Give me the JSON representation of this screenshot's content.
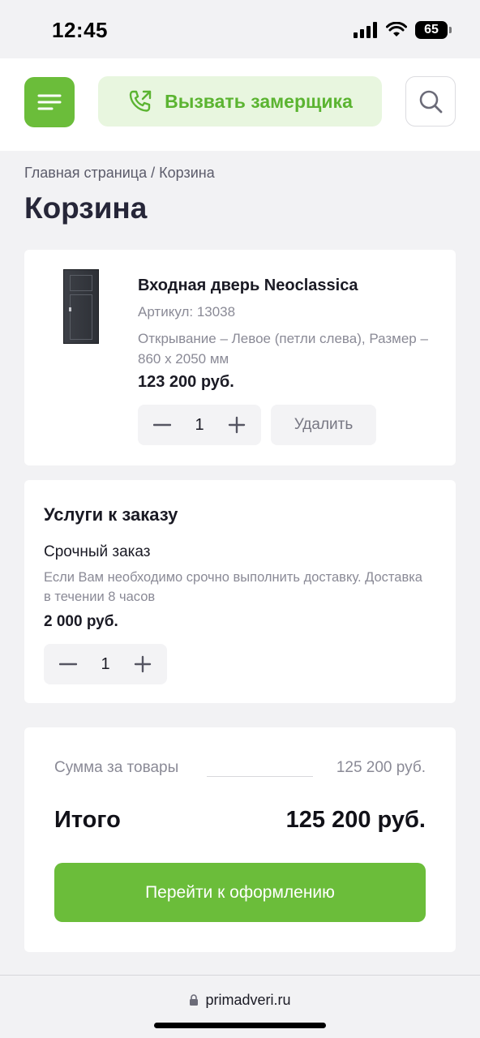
{
  "status": {
    "time": "12:45",
    "battery": "65"
  },
  "header": {
    "call_label": "Вызвать замерщика"
  },
  "breadcrumb": {
    "home": "Главная страница",
    "separator": "/",
    "current": "Корзина"
  },
  "page_title": "Корзина",
  "product": {
    "name": "Входная дверь Neoclassica",
    "sku": "Артикул: 13038",
    "options": "Открывание – Левое (петли слева), Размер – 860 х 2050 мм",
    "price": "123 200 руб.",
    "quantity": "1",
    "delete_label": "Удалить"
  },
  "services": {
    "title": "Услуги к заказу",
    "item_name": "Срочный заказ",
    "item_desc": "Если Вам необходимо срочно выполнить доставку. Доставка в течении 8 часов",
    "item_price": "2 000 руб.",
    "quantity": "1"
  },
  "summary": {
    "subtotal_label": "Сумма за товары",
    "subtotal_value": "125 200 руб.",
    "total_label": "Итого",
    "total_value": "125 200 руб.",
    "checkout_label": "Перейти к оформлению"
  },
  "browser": {
    "url": "primadveri.ru"
  },
  "colors": {
    "accent": "#6bbd3a",
    "accent_light": "#e8f6df"
  }
}
